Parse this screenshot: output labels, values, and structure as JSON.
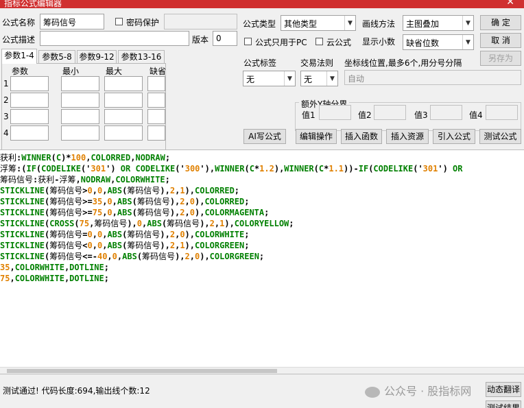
{
  "window": {
    "title": "指标公式编辑器",
    "close_glyph": "✕"
  },
  "form": {
    "name_label": "公式名称",
    "name_value": "筹码信号",
    "password_label": "密码保护",
    "type_label": "公式类型",
    "type_value": "其他类型",
    "draw_label": "画线方法",
    "draw_value": "主图叠加",
    "desc_label": "公式描述",
    "version_label": "版本",
    "version_value": "0",
    "pc_only_label": "公式只用于PC",
    "cloud_label": "云公式",
    "decimals_label": "显示小数",
    "decimals_value": "缺省位数"
  },
  "buttons": {
    "ok": "确  定",
    "cancel": "取  消",
    "save_as": "另存为",
    "ai": "AI写公式",
    "edit_ops": "编辑操作",
    "insert_func": "插入函数",
    "insert_res": "插入资源",
    "import": "引入公式",
    "test": "测试公式",
    "translate": "动态翻译",
    "test_result": "测试结果"
  },
  "params": {
    "tabs": [
      "参数1-4",
      "参数5-8",
      "参数9-12",
      "参数13-16"
    ],
    "headers": [
      "参数",
      "最小",
      "最大",
      "缺省"
    ],
    "rows": [
      "1",
      "2",
      "3",
      "4"
    ]
  },
  "tags": {
    "label": "公式标签",
    "value": "无",
    "rule_label": "交易法则",
    "rule_value": "无",
    "coord_label": "坐标线位置,最多6个,用分号分隔",
    "coord_value": "自动"
  },
  "yaxis": {
    "title": "额外Y轴分界",
    "labels": [
      "值1",
      "值2",
      "值3",
      "值4"
    ]
  },
  "code_lines": [
    [
      [
        "k",
        "获利"
      ],
      [
        "b",
        ":"
      ],
      [
        "g",
        "WINNER"
      ],
      [
        "b",
        "("
      ],
      [
        "g",
        "C"
      ],
      [
        "b",
        ")*"
      ],
      [
        "o",
        "100"
      ],
      [
        "b",
        ","
      ],
      [
        "g",
        "COLORRED"
      ],
      [
        "b",
        ","
      ],
      [
        "g",
        "NODRAW"
      ],
      [
        "b",
        ";"
      ]
    ],
    [
      [
        "k",
        "浮筹"
      ],
      [
        "b",
        ":("
      ],
      [
        "g",
        "IF"
      ],
      [
        "b",
        "("
      ],
      [
        "g",
        "CODELIKE"
      ],
      [
        "b",
        "('"
      ],
      [
        "o",
        "301"
      ],
      [
        "b",
        "') "
      ],
      [
        "g",
        "OR"
      ],
      [
        "b",
        " "
      ],
      [
        "g",
        "CODELIKE"
      ],
      [
        "b",
        "('"
      ],
      [
        "o",
        "300"
      ],
      [
        "b",
        "'),"
      ],
      [
        "g",
        "WINNER"
      ],
      [
        "b",
        "("
      ],
      [
        "g",
        "C"
      ],
      [
        "b",
        "*"
      ],
      [
        "o",
        "1.2"
      ],
      [
        "b",
        "),"
      ],
      [
        "g",
        "WINNER"
      ],
      [
        "b",
        "("
      ],
      [
        "g",
        "C"
      ],
      [
        "b",
        "*"
      ],
      [
        "o",
        "1.1"
      ],
      [
        "b",
        "))-"
      ],
      [
        "g",
        "IF"
      ],
      [
        "b",
        "("
      ],
      [
        "g",
        "CODELIKE"
      ],
      [
        "b",
        "('"
      ],
      [
        "o",
        "301"
      ],
      [
        "b",
        "') "
      ],
      [
        "g",
        "OR"
      ]
    ],
    [
      [
        "k",
        "筹码信号"
      ],
      [
        "b",
        ":"
      ],
      [
        "k",
        "获利"
      ],
      [
        "b",
        "-"
      ],
      [
        "k",
        "浮筹"
      ],
      [
        "b",
        ","
      ],
      [
        "g",
        "NODRAW"
      ],
      [
        "b",
        ","
      ],
      [
        "g",
        "COLORWHITE"
      ],
      [
        "b",
        ";"
      ]
    ],
    [
      [
        "g",
        "STICKLINE"
      ],
      [
        "b",
        "("
      ],
      [
        "k",
        "筹码信号"
      ],
      [
        "b",
        ">"
      ],
      [
        "o",
        "0"
      ],
      [
        "b",
        ","
      ],
      [
        "o",
        "0"
      ],
      [
        "b",
        ","
      ],
      [
        "g",
        "ABS"
      ],
      [
        "b",
        "("
      ],
      [
        "k",
        "筹码信号"
      ],
      [
        "b",
        "),"
      ],
      [
        "o",
        "2"
      ],
      [
        "b",
        ","
      ],
      [
        "o",
        "1"
      ],
      [
        "b",
        "),"
      ],
      [
        "g",
        "COLORRED"
      ],
      [
        "b",
        ";"
      ]
    ],
    [
      [
        "g",
        "STICKLINE"
      ],
      [
        "b",
        "("
      ],
      [
        "k",
        "筹码信号"
      ],
      [
        "b",
        ">="
      ],
      [
        "o",
        "35"
      ],
      [
        "b",
        ","
      ],
      [
        "o",
        "0"
      ],
      [
        "b",
        ","
      ],
      [
        "g",
        "ABS"
      ],
      [
        "b",
        "("
      ],
      [
        "k",
        "筹码信号"
      ],
      [
        "b",
        "),"
      ],
      [
        "o",
        "2"
      ],
      [
        "b",
        ","
      ],
      [
        "o",
        "0"
      ],
      [
        "b",
        "),"
      ],
      [
        "g",
        "COLORRED"
      ],
      [
        "b",
        ";"
      ]
    ],
    [
      [
        "g",
        "STICKLINE"
      ],
      [
        "b",
        "("
      ],
      [
        "k",
        "筹码信号"
      ],
      [
        "b",
        ">="
      ],
      [
        "o",
        "75"
      ],
      [
        "b",
        ","
      ],
      [
        "o",
        "0"
      ],
      [
        "b",
        ","
      ],
      [
        "g",
        "ABS"
      ],
      [
        "b",
        "("
      ],
      [
        "k",
        "筹码信号"
      ],
      [
        "b",
        "),"
      ],
      [
        "o",
        "2"
      ],
      [
        "b",
        ","
      ],
      [
        "o",
        "0"
      ],
      [
        "b",
        "),"
      ],
      [
        "g",
        "COLORMAGENTA"
      ],
      [
        "b",
        ";"
      ]
    ],
    [
      [
        "g",
        "STICKLINE"
      ],
      [
        "b",
        "("
      ],
      [
        "g",
        "CROSS"
      ],
      [
        "b",
        "("
      ],
      [
        "o",
        "75"
      ],
      [
        "b",
        ","
      ],
      [
        "k",
        "筹码信号"
      ],
      [
        "b",
        "),"
      ],
      [
        "o",
        "0"
      ],
      [
        "b",
        ","
      ],
      [
        "g",
        "ABS"
      ],
      [
        "b",
        "("
      ],
      [
        "k",
        "筹码信号"
      ],
      [
        "b",
        "),"
      ],
      [
        "o",
        "2"
      ],
      [
        "b",
        ","
      ],
      [
        "o",
        "1"
      ],
      [
        "b",
        "),"
      ],
      [
        "g",
        "COLORYELLOW"
      ],
      [
        "b",
        ";"
      ]
    ],
    [
      [
        "g",
        "STICKLINE"
      ],
      [
        "b",
        "("
      ],
      [
        "k",
        "筹码信号"
      ],
      [
        "b",
        "="
      ],
      [
        "o",
        "0"
      ],
      [
        "b",
        ","
      ],
      [
        "o",
        "0"
      ],
      [
        "b",
        ","
      ],
      [
        "g",
        "ABS"
      ],
      [
        "b",
        "("
      ],
      [
        "k",
        "筹码信号"
      ],
      [
        "b",
        "),"
      ],
      [
        "o",
        "2"
      ],
      [
        "b",
        ","
      ],
      [
        "o",
        "0"
      ],
      [
        "b",
        "),"
      ],
      [
        "g",
        "COLORWHITE"
      ],
      [
        "b",
        ";"
      ]
    ],
    [
      [
        "g",
        "STICKLINE"
      ],
      [
        "b",
        "("
      ],
      [
        "k",
        "筹码信号"
      ],
      [
        "b",
        "<"
      ],
      [
        "o",
        "0"
      ],
      [
        "b",
        ","
      ],
      [
        "o",
        "0"
      ],
      [
        "b",
        ","
      ],
      [
        "g",
        "ABS"
      ],
      [
        "b",
        "("
      ],
      [
        "k",
        "筹码信号"
      ],
      [
        "b",
        "),"
      ],
      [
        "o",
        "2"
      ],
      [
        "b",
        ","
      ],
      [
        "o",
        "1"
      ],
      [
        "b",
        "),"
      ],
      [
        "g",
        "COLORGREEN"
      ],
      [
        "b",
        ";"
      ]
    ],
    [
      [
        "g",
        "STICKLINE"
      ],
      [
        "b",
        "("
      ],
      [
        "k",
        "筹码信号"
      ],
      [
        "b",
        "<=-"
      ],
      [
        "o",
        "40"
      ],
      [
        "b",
        ","
      ],
      [
        "o",
        "0"
      ],
      [
        "b",
        ","
      ],
      [
        "g",
        "ABS"
      ],
      [
        "b",
        "("
      ],
      [
        "k",
        "筹码信号"
      ],
      [
        "b",
        "),"
      ],
      [
        "o",
        "2"
      ],
      [
        "b",
        ","
      ],
      [
        "o",
        "0"
      ],
      [
        "b",
        "),"
      ],
      [
        "g",
        "COLORGREEN"
      ],
      [
        "b",
        ";"
      ]
    ],
    [
      [
        "o",
        "35"
      ],
      [
        "b",
        ","
      ],
      [
        "g",
        "COLORWHITE"
      ],
      [
        "b",
        ","
      ],
      [
        "g",
        "DOTLINE"
      ],
      [
        "b",
        ";"
      ]
    ],
    [
      [
        "o",
        "75"
      ],
      [
        "b",
        ","
      ],
      [
        "g",
        "COLORWHITE"
      ],
      [
        "b",
        ","
      ],
      [
        "g",
        "DOTLINE"
      ],
      [
        "b",
        ";"
      ]
    ]
  ],
  "status": {
    "message": "测试通过! 代码长度:694,输出线个数:12",
    "watermark": "公众号 · 股指标网"
  },
  "colors": {
    "title_bar": "#d03030",
    "code_green": "#008000",
    "code_orange": "#e08000",
    "code_black": "#000000"
  }
}
